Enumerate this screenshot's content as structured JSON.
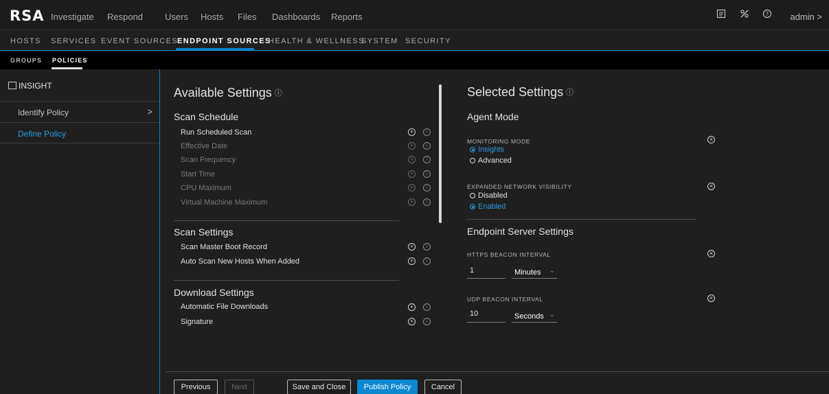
{
  "topnav": {
    "logo": "RSA",
    "items": [
      "Investigate",
      "Respond",
      "Users",
      "Hosts",
      "Files",
      "Dashboards",
      "Reports"
    ],
    "user": "admin >"
  },
  "subnav": {
    "items": [
      "HOSTS",
      "SERVICES",
      "EVENT SOURCES",
      "ENDPOINT SOURCES",
      "HEALTH & WELLNESS",
      "SYSTEM",
      "SECURITY"
    ],
    "active": "ENDPOINT SOURCES"
  },
  "tertnav": {
    "items": [
      "GROUPS",
      "POLICIES"
    ],
    "active": "POLICIES"
  },
  "leftpanel": {
    "header": "INSIGHT",
    "items": [
      "Identify Policy",
      "Define Policy"
    ],
    "active": "Define Policy"
  },
  "available": {
    "title": "Available Settings",
    "groups": [
      {
        "title": "Scan Schedule",
        "rows": [
          {
            "label": "Run Scheduled Scan",
            "enabled": true
          },
          {
            "label": "Effective Date",
            "enabled": false
          },
          {
            "label": "Scan Frequency",
            "enabled": false
          },
          {
            "label": "Start Time",
            "enabled": false
          },
          {
            "label": "CPU Maximum",
            "enabled": false
          },
          {
            "label": "Virtual Machine Maximum",
            "enabled": false
          }
        ]
      },
      {
        "title": "Scan Settings",
        "rows": [
          {
            "label": "Scan Master Boot Record",
            "enabled": true
          },
          {
            "label": "Auto Scan New Hosts When Added",
            "enabled": true
          }
        ]
      },
      {
        "title": "Download Settings",
        "rows": [
          {
            "label": "Automatic File Downloads",
            "enabled": true
          },
          {
            "label": "Signature",
            "enabled": true
          }
        ]
      }
    ]
  },
  "selected": {
    "title": "Selected Settings",
    "agent_mode": {
      "title": "Agent Mode",
      "monitoring_mode": {
        "label": "MONITORING MODE",
        "options": [
          "Insights",
          "Advanced"
        ],
        "selected": "Insights"
      },
      "network_visibility": {
        "label": "EXPANDED NETWORK VISIBILITY",
        "options": [
          "Disabled",
          "Enabled"
        ],
        "selected": "Enabled"
      }
    },
    "endpoint_server": {
      "title": "Endpoint Server Settings",
      "https_beacon": {
        "label": "HTTPS BEACON INTERVAL",
        "value": "1",
        "unit": "Minutes"
      },
      "udp_beacon": {
        "label": "UDP BEACON INTERVAL",
        "value": "10",
        "unit": "Seconds"
      }
    }
  },
  "footer": {
    "previous": "Previous",
    "next": "Next",
    "save_close": "Save and Close",
    "publish": "Publish Policy",
    "cancel": "Cancel"
  }
}
